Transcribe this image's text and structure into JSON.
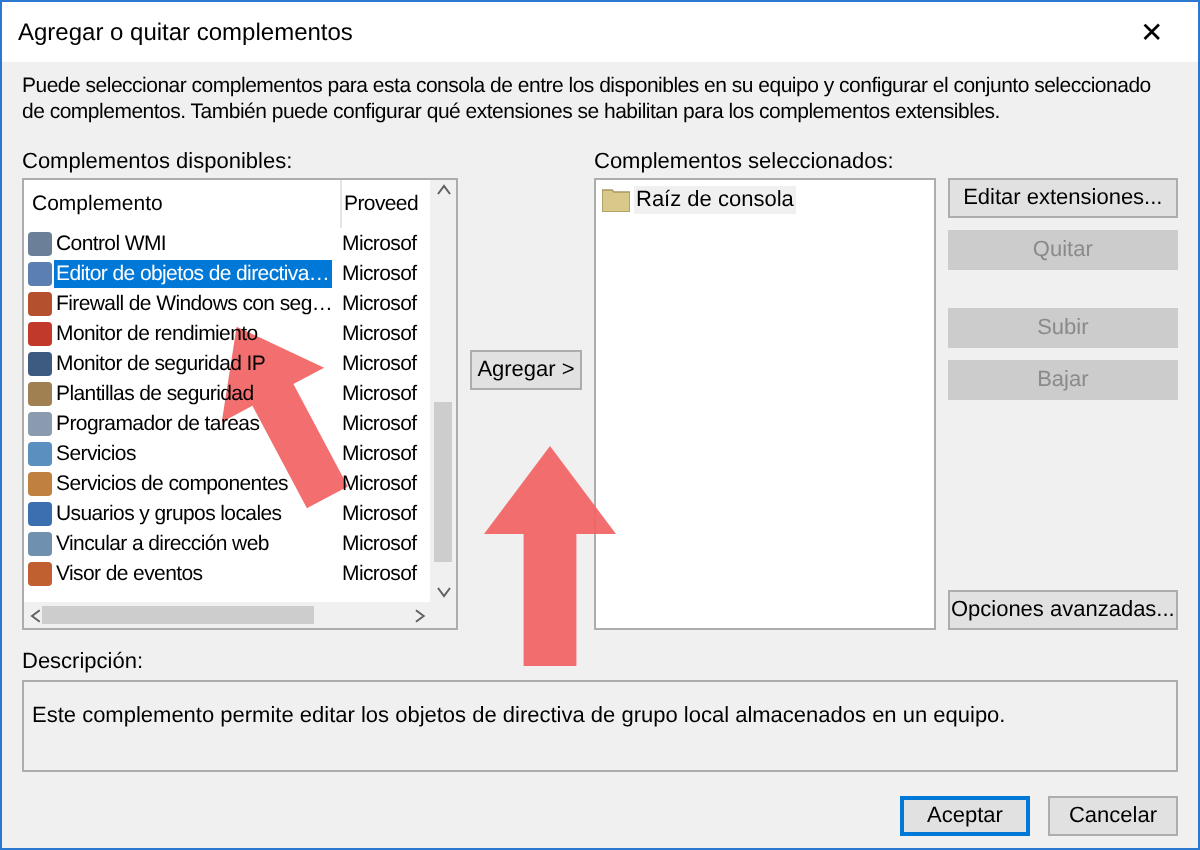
{
  "window": {
    "title": "Agregar o quitar complementos",
    "close": "✕"
  },
  "intro": "Puede seleccionar complementos para esta consola de entre los disponibles en su equipo y configurar el conjunto seleccionado de complementos. También puede configurar qué extensiones se habilitan para los complementos extensibles.",
  "available": {
    "label": "Complementos disponibles:",
    "columns": [
      "Complemento",
      "Proveed"
    ],
    "rows": [
      {
        "name": "Control WMI",
        "provider": "Microsof",
        "selected": false,
        "color": "#6b7f99"
      },
      {
        "name": "Editor de objetos de directiva…",
        "provider": "Microsof",
        "selected": true,
        "color": "#5a7fb0"
      },
      {
        "name": "Firewall de Windows con seg…",
        "provider": "Microsof",
        "selected": false,
        "color": "#b5502e"
      },
      {
        "name": "Monitor de rendimiento",
        "provider": "Microsof",
        "selected": false,
        "color": "#c0392b"
      },
      {
        "name": "Monitor de seguridad IP",
        "provider": "Microsof",
        "selected": false,
        "color": "#3d5a80"
      },
      {
        "name": "Plantillas de seguridad",
        "provider": "Microsof",
        "selected": false,
        "color": "#a08050"
      },
      {
        "name": "Programador de tareas",
        "provider": "Microsof",
        "selected": false,
        "color": "#8a9bb0"
      },
      {
        "name": "Servicios",
        "provider": "Microsof",
        "selected": false,
        "color": "#5a8fc0"
      },
      {
        "name": "Servicios de componentes",
        "provider": "Microsof",
        "selected": false,
        "color": "#c08040"
      },
      {
        "name": "Usuarios y grupos locales",
        "provider": "Microsof",
        "selected": false,
        "color": "#3a6fb0"
      },
      {
        "name": "Vincular a dirección web",
        "provider": "Microsof",
        "selected": false,
        "color": "#7090b0"
      },
      {
        "name": "Visor de eventos",
        "provider": "Microsof",
        "selected": false,
        "color": "#c06030"
      }
    ]
  },
  "add_button": "Agregar >",
  "selected": {
    "label": "Complementos seleccionados:",
    "items": [
      "Raíz de consola"
    ]
  },
  "side_buttons": [
    {
      "label": "Editar extensiones...",
      "disabled": false
    },
    {
      "label": "Quitar",
      "disabled": true
    },
    {
      "label": "Subir",
      "disabled": true
    },
    {
      "label": "Bajar",
      "disabled": true
    }
  ],
  "advanced_button": "Opciones avanzadas...",
  "description": {
    "label": "Descripción:",
    "text": "Este complemento permite editar los objetos de directiva de grupo local almacenados en un equipo."
  },
  "footer_buttons": [
    {
      "label": "Aceptar",
      "default": true
    },
    {
      "label": "Cancelar",
      "default": false
    }
  ]
}
